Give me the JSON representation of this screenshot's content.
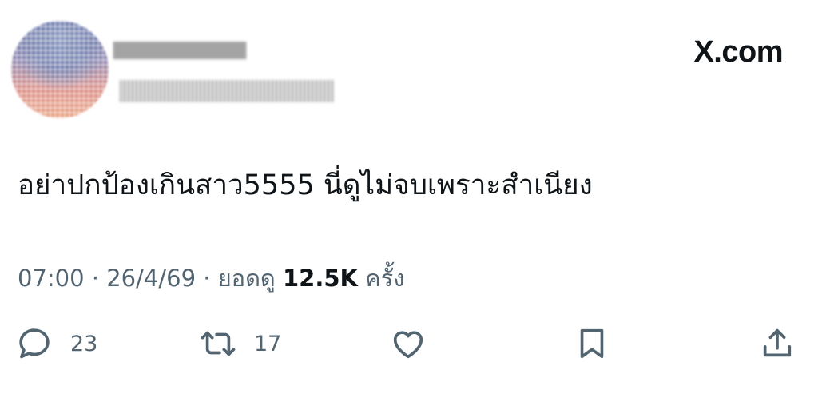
{
  "header": {
    "brand": "X.com"
  },
  "tweet": {
    "text": "อย่าปกป้องเกินสาว5555 นี่ดูไม่จบเพราะสำเนียง"
  },
  "meta": {
    "time": "07:00",
    "sep1": " · ",
    "date": "26/4/69",
    "sep2": " · ",
    "views_label": "ยอดดู",
    "views_count": "12.5K",
    "views_unit": "ครั้ง"
  },
  "actions": {
    "reply_count": "23",
    "repost_count": "17",
    "like_icon": "heart-icon",
    "bookmark_icon": "bookmark-icon",
    "share_icon": "share-icon"
  },
  "colors": {
    "text": "#0f1419",
    "muted": "#536471",
    "background": "#ffffff"
  }
}
